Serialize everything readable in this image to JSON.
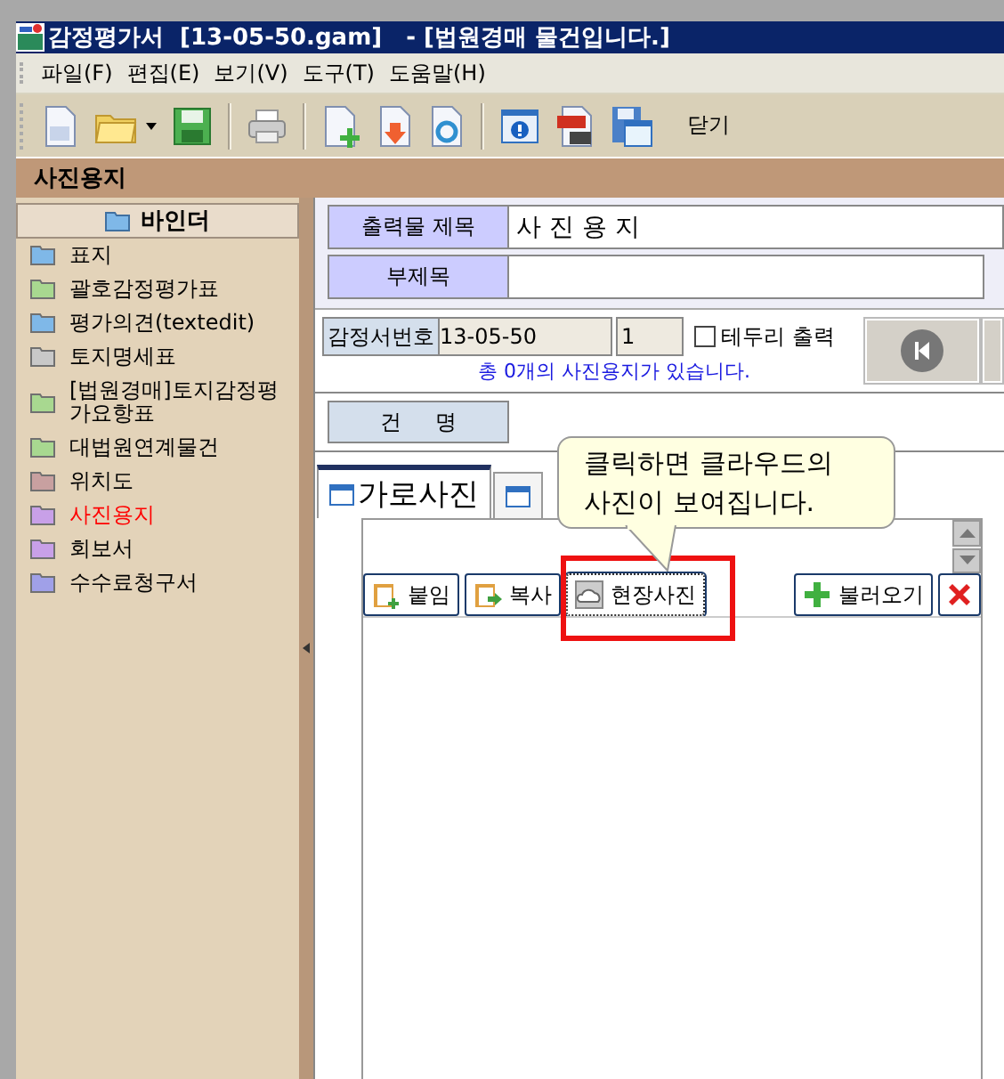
{
  "window": {
    "title": "감정평가서  [13-05-50.gam]   - [법원경매 물건입니다.]"
  },
  "menu": [
    "파일(F)",
    "편집(E)",
    "보기(V)",
    "도구(T)",
    "도움말(H)"
  ],
  "toolbar": {
    "close_label": "닫기"
  },
  "section_title": "사진용지",
  "sidebar": {
    "header": "바인더",
    "items": [
      {
        "label": "표지",
        "color": "#7fb8e8",
        "selected": false
      },
      {
        "label": "괄호감정평가표",
        "color": "#a8d890",
        "selected": false
      },
      {
        "label": "평가의견(textedit)",
        "color": "#7fb8e8",
        "selected": false
      },
      {
        "label": "토지명세표",
        "color": "#c8c8c8",
        "selected": false
      },
      {
        "label": "[법원경매]토지감정평가요항표",
        "color": "#a8d890",
        "selected": false
      },
      {
        "label": "대법원연계물건",
        "color": "#a8d890",
        "selected": false
      },
      {
        "label": "위치도",
        "color": "#c8a0a0",
        "selected": false
      },
      {
        "label": "사진용지",
        "color": "#c8a0e8",
        "selected": true
      },
      {
        "label": "회보서",
        "color": "#c8a0e8",
        "selected": false
      },
      {
        "label": "수수료청구서",
        "color": "#a0a0e8",
        "selected": false
      }
    ]
  },
  "form": {
    "title_label": "출력물 제목",
    "title_value": "사 진 용 지",
    "subtitle_label": "부제목",
    "number_label": "감정서번호",
    "number_value": "13-05-50",
    "page_value": "1",
    "border_print": {
      "label": "테두리 출력",
      "checked": false
    },
    "notice": "총 0개의 사진용지가 있습니다.",
    "case_label": "건     명"
  },
  "tabs": [
    {
      "label": "가로사진",
      "selected": true
    },
    {
      "selected": false
    }
  ],
  "buttons": [
    "붙임",
    "복사",
    "현장사진",
    "불러오기"
  ],
  "callout": "클릭하면 클라우드의\n사진이 보여집니다."
}
